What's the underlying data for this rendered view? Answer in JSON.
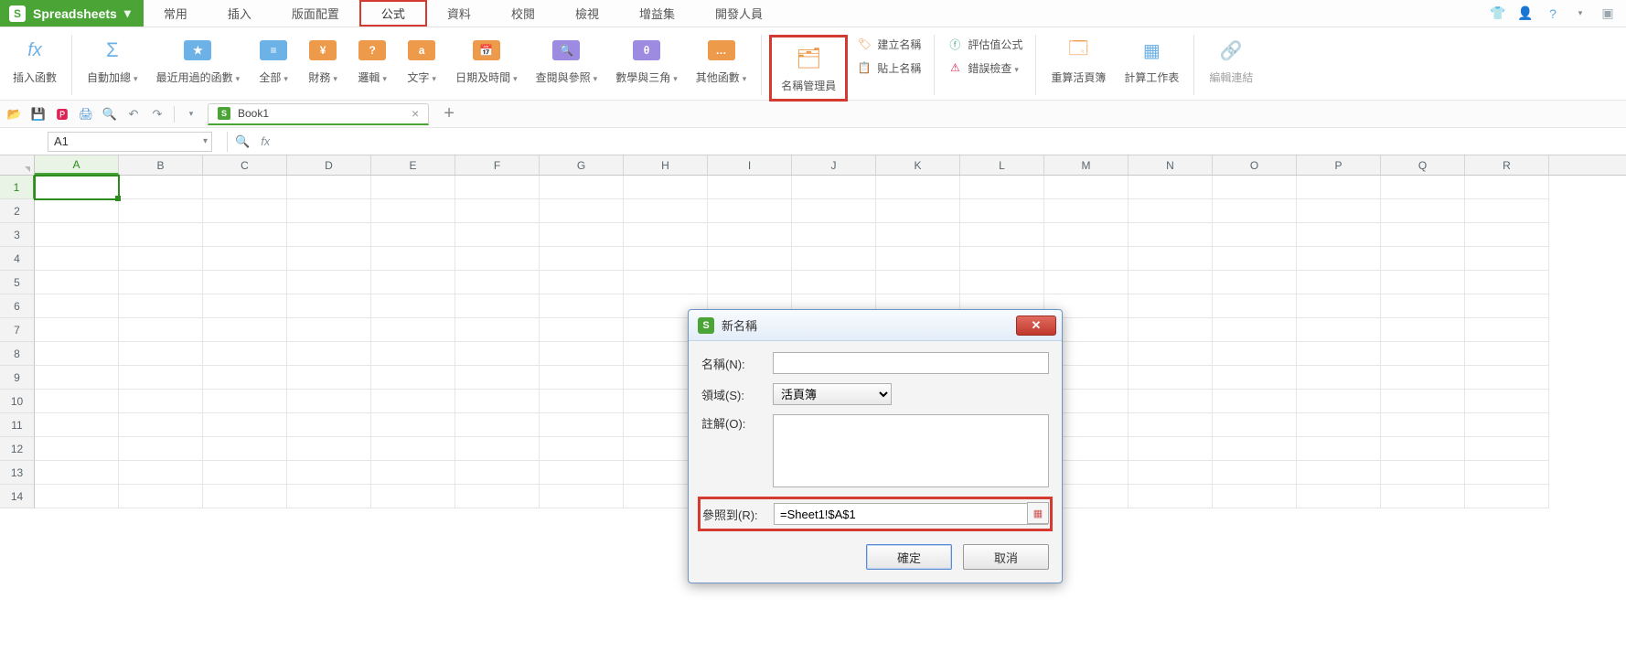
{
  "app": {
    "name": "Spreadsheets"
  },
  "menus": [
    "常用",
    "插入",
    "版面配置",
    "公式",
    "資料",
    "校閱",
    "檢視",
    "增益集",
    "開發人員"
  ],
  "active_menu_index": 3,
  "ribbon": {
    "insert_fn": "插入函數",
    "autosum": "自動加總",
    "recent": "最近用過的函數",
    "all": "全部",
    "finance": "財務",
    "logic": "邏輯",
    "text": "文字",
    "datetime": "日期及時間",
    "lookup": "查閱與參照",
    "math": "數學與三角",
    "other": "其他函數",
    "name_mgr": "名稱管理員",
    "create_name": "建立名稱",
    "paste_name": "貼上名稱",
    "eval": "評估值公式",
    "err": "錯誤檢查",
    "recalc_book": "重算活頁簿",
    "calc_sheet": "計算工作表",
    "edit_links": "編輯連結"
  },
  "doc_tab": "Book1",
  "namebox": "A1",
  "columns": [
    "A",
    "B",
    "C",
    "D",
    "E",
    "F",
    "G",
    "H",
    "I",
    "J",
    "K",
    "L",
    "M",
    "N",
    "O",
    "P",
    "Q",
    "R"
  ],
  "row_count": 14,
  "dialog": {
    "title": "新名稱",
    "name_label": "名稱(N):",
    "scope_label": "領域(S):",
    "scope_value": "活頁簿",
    "comment_label": "註解(O):",
    "ref_label": "參照到(R):",
    "ref_value": "=Sheet1!$A$1",
    "ok": "確定",
    "cancel": "取消"
  }
}
